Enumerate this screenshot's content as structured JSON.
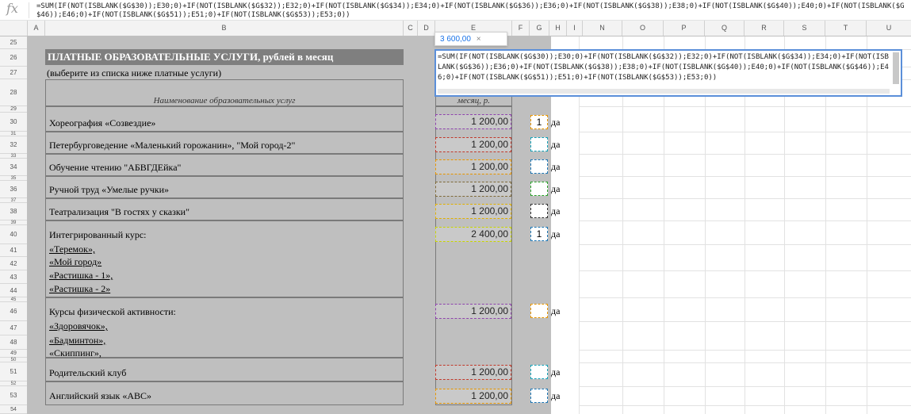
{
  "formula_bar": {
    "fx_label": "fx",
    "text": "=SUM(IF(NOT(ISBLANK($G$30));E30;0)+IF(NOT(ISBLANK($G$32));E32;0)+IF(NOT(ISBLANK($G$34));E34;0)+IF(NOT(ISBLANK($G$36));E36;0)+IF(NOT(ISBLANK($G$38));E38;0)+IF(NOT(ISBLANK($G$40));E40;0)+IF(NOT(ISBLANK($G$46));E46;0)+IF(NOT(ISBLANK($G$51));E51;0)+IF(NOT(ISBLANK($G$53));E53;0))"
  },
  "columns": [
    "A",
    "B",
    "C",
    "D",
    "E",
    "F",
    "G",
    "H",
    "I",
    "N",
    "O",
    "P",
    "Q",
    "R",
    "S",
    "T",
    "U"
  ],
  "rows": [
    "25",
    "26",
    "27",
    "28",
    "29",
    "30",
    "31",
    "32",
    "33",
    "34",
    "35",
    "36",
    "37",
    "38",
    "39",
    "40",
    "41",
    "42",
    "43",
    "44",
    "45",
    "46",
    "47",
    "48",
    "49",
    "50",
    "51",
    "52",
    "53",
    "54"
  ],
  "sheet": {
    "title": "ПЛАТНЫЕ ОБРАЗОВАТЕЛЬНЫЕ УСЛУГИ, рублей в месяц",
    "subtitle": "(выберите из списка ниже платные услуги)",
    "header_name": "Наименование образовательных услуг",
    "header_price": "месяц, р.",
    "services": [
      {
        "name": "Хореография «Созвездие»",
        "price": "1 200,00",
        "check": "1",
        "yes": "да"
      },
      {
        "name": "Петербурговедение «Маленький горожанин», \"Мой город-2\"",
        "price": "1 200,00",
        "check": "",
        "yes": "да"
      },
      {
        "name": "Обучение чтению \"АБВГДЕйка\"",
        "price": "1 200,00",
        "check": "",
        "yes": "да"
      },
      {
        "name": "Ручной труд «Умелые ручки»",
        "price": "1 200,00",
        "check": "",
        "yes": "да"
      },
      {
        "name": "Театрализация \"В гостях у сказки\"",
        "price": "1 200,00",
        "check": "",
        "yes": "да"
      },
      {
        "name": "Интегрированный курс:",
        "price": "2 400,00",
        "check": "1",
        "yes": "да"
      },
      {
        "name": "Курсы физической активности:",
        "price": "1 200,00",
        "check": "",
        "yes": "да"
      },
      {
        "name": "Родительский клуб",
        "price": "1 200,00",
        "check": "",
        "yes": "да"
      },
      {
        "name": "Английский язык «ABC»",
        "price": "1 200,00",
        "check": "",
        "yes": "да"
      }
    ],
    "integrated_sub": [
      "«Теремок»,",
      "«Мой город»",
      "«Растишка - 1»,",
      "«Растишка - 2»"
    ],
    "physical_sub": [
      "«Здоровячок»,",
      "«Бадминтон»,",
      "«Скиппинг»,"
    ]
  },
  "editor": {
    "tooltip_value": "3 600,00",
    "tooltip_close": "×",
    "content": "=SUM(IF(NOT(ISBLANK($G$30));E30;0)+IF(NOT(ISBLANK($G$32));E32;0)+IF(NOT(ISBLANK($G$34));E34;0)+IF(NOT(ISBLANK($G$36));E36;0)+IF(NOT(ISBLANK($G$38));E38;0)+IF(NOT(ISBLANK($G$40));E40;0)+IF(NOT(ISBLANK($G$46));E46;0)+IF(NOT(ISBLANK($G$51));E51;0)+IF(NOT(ISBLANK($G$53));E53;0))"
  },
  "colors": {
    "range_colors": [
      "#8e44ad",
      "#c0392b",
      "#e69500",
      "#7f6a3a",
      "#e0b000",
      "#c8d400",
      "#8e44ad",
      "#c0392b",
      "#e69500"
    ],
    "check_colors": [
      "#e69500",
      "#17a2b8",
      "#1f77b4",
      "#2ca02c",
      "#333333",
      "#1f77b4",
      "#e69500",
      "#17a2b8",
      "#1f77b4"
    ],
    "editor_border": "#5b8fd9"
  }
}
